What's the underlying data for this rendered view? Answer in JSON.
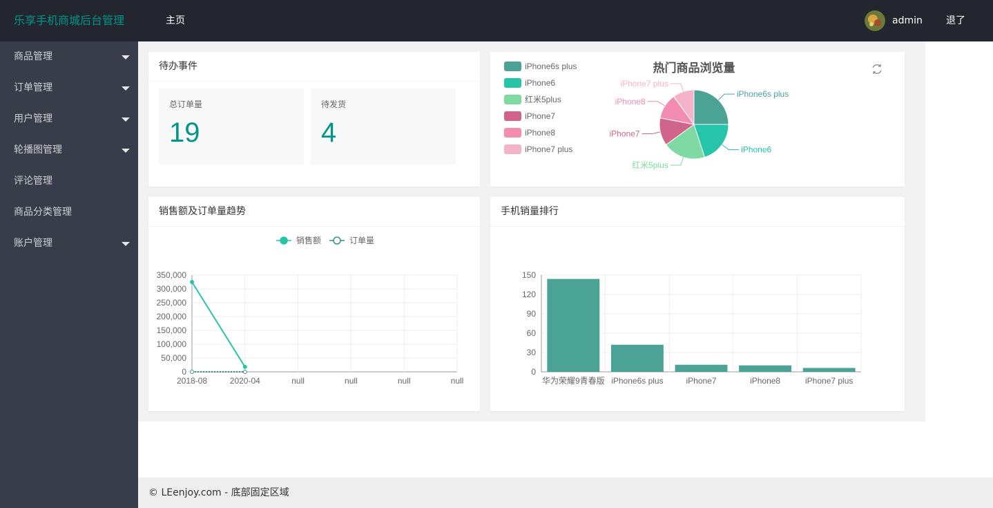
{
  "header": {
    "logo": "乐享手机商城后台管理",
    "nav_home": "主页",
    "user_name": "admin",
    "logout": "退了"
  },
  "sidebar": {
    "items": [
      {
        "label": "商品管理",
        "has_caret": true
      },
      {
        "label": "订单管理",
        "has_caret": true
      },
      {
        "label": "用户管理",
        "has_caret": true
      },
      {
        "label": "轮播图管理",
        "has_caret": true
      },
      {
        "label": "评论管理",
        "has_caret": false
      },
      {
        "label": "商品分类管理",
        "has_caret": false
      },
      {
        "label": "账户管理",
        "has_caret": true
      }
    ]
  },
  "todo": {
    "title": "待办事件",
    "stats": [
      {
        "label": "总订单量",
        "value": "19"
      },
      {
        "label": "待发货",
        "value": "4"
      }
    ]
  },
  "line_card": {
    "title": "销售额及订单量趋势"
  },
  "bar_card": {
    "title": "手机销量排行"
  },
  "footer": {
    "text": "© LEenjoy.com - 底部固定区域"
  },
  "colors": {
    "accent": "#009688",
    "header_bg": "#23262e",
    "sidebar_bg": "#393d49"
  },
  "chart_data": [
    {
      "type": "pie",
      "title": "热门商品浏览量",
      "legend_position": "left",
      "categories": [
        "iPhone6s plus",
        "iPhone6",
        "红米5plus",
        "iPhone7",
        "iPhone8",
        "iPhone7 plus"
      ],
      "values": [
        25,
        20,
        20,
        13,
        12,
        10
      ],
      "colors": [
        "#4ba395",
        "#26c4a8",
        "#7fd9a3",
        "#d0648a",
        "#f28cb1",
        "#f4b3c8"
      ]
    },
    {
      "type": "line",
      "legend": [
        "销售额",
        "订单量"
      ],
      "legend_position": "top",
      "x": [
        "2018-08",
        "2020-04",
        "null",
        "null",
        "null",
        "null"
      ],
      "ylim": [
        0,
        350000
      ],
      "yticks": [
        "0",
        "50,000",
        "100,000",
        "150,000",
        "200,000",
        "250,000",
        "300,000",
        "350,000"
      ],
      "grid": true,
      "series": [
        {
          "name": "销售额",
          "values": [
            325000,
            18000
          ],
          "color": "#26c4a8"
        },
        {
          "name": "订单量",
          "values": [
            2,
            2
          ],
          "color": "#3a8f85"
        }
      ]
    },
    {
      "type": "bar",
      "categories": [
        "华为荣耀9青春版",
        "iPhone6s plus",
        "iPhone7",
        "iPhone8",
        "iPhone7 plus"
      ],
      "values": [
        144,
        42,
        11,
        10,
        6
      ],
      "ylim": [
        0,
        150
      ],
      "yticks": [
        "0",
        "30",
        "60",
        "90",
        "120",
        "150"
      ],
      "grid": true,
      "color": "#4ba395"
    }
  ]
}
